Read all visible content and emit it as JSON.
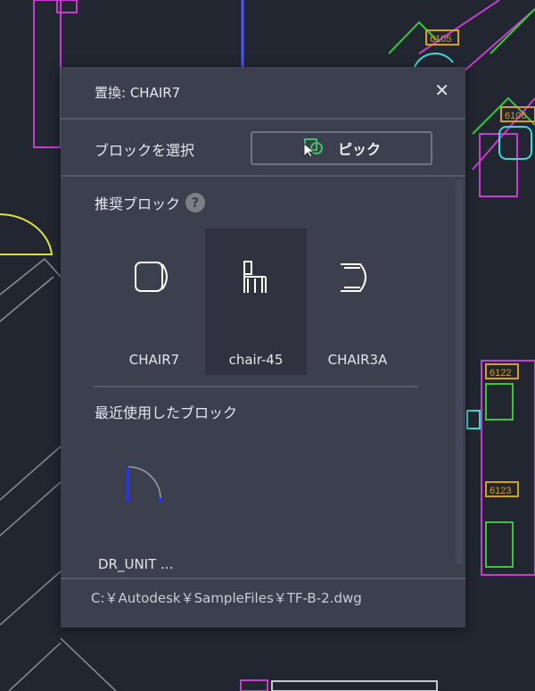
{
  "cad_labels": [
    "6105",
    "6106",
    "6122",
    "6123"
  ],
  "dialog": {
    "title": "置換: CHAIR7",
    "close_icon": "close-icon",
    "select_block_label": "ブロックを選択",
    "pick_button_label": "ピック",
    "pick_icon": "pick-cursor-icon",
    "recommended_header": "推奨ブロック",
    "help_glyph": "?",
    "recommended_blocks": [
      {
        "label": "CHAIR7",
        "selected": false
      },
      {
        "label": "chair-45",
        "selected": true
      },
      {
        "label": "CHAIR3A",
        "selected": false
      }
    ],
    "recent_header": "最近使用したブロック",
    "recent_blocks": [
      {
        "label": "DR_UNIT ..."
      }
    ],
    "file_path": "C:￥Autodesk￥SampleFiles￥TF-B-2.dwg"
  },
  "colors": {
    "dialog_bg": "#3b3f4e",
    "canvas_bg": "#222631",
    "pick_icon": "#3fbf6a"
  }
}
